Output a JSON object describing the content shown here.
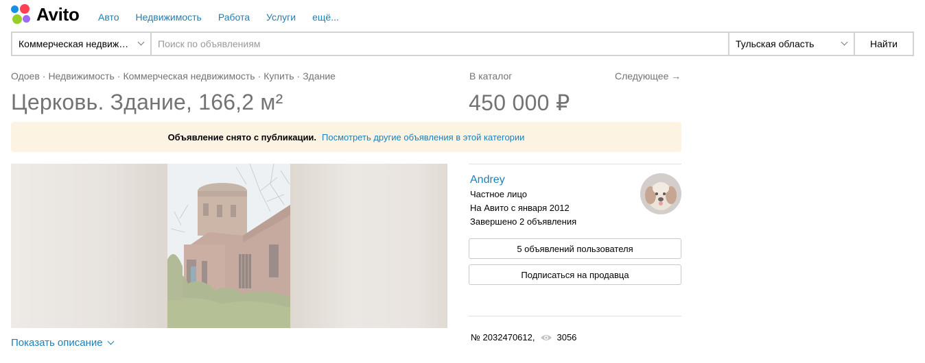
{
  "header": {
    "logo": "Avito",
    "nav": [
      "Авто",
      "Недвижимость",
      "Работа",
      "Услуги",
      "ещё..."
    ]
  },
  "search": {
    "category": "Коммерческая недвиж…",
    "placeholder": "Поиск по объявлениям",
    "region": "Тульская область",
    "button": "Найти"
  },
  "breadcrumb": [
    "Одоев",
    "Недвижимость",
    "Коммерческая недвижимость",
    "Купить",
    "Здание"
  ],
  "catalog_link": "В каталог",
  "next_link": "Следующее →",
  "listing": {
    "title": "Церковь. Здание, 166,2 м²",
    "price": "450 000 ₽",
    "show_description": "Показать описание"
  },
  "notice": {
    "text": "Объявление снято с публикации.",
    "link": "Посмотреть другие объявления в этой категории"
  },
  "seller": {
    "name": "Andrey",
    "type": "Частное лицо",
    "since": "На Авито с января 2012",
    "completed": "Завершено 2 объявления",
    "listings_button": "5 объявлений пользователя",
    "subscribe_button": "Подписаться на продавца"
  },
  "meta": {
    "number": "№ 2032470612,",
    "views": "3056"
  },
  "colors": {
    "link": "#1c7fb5",
    "notice_bg": "#fdf3e3",
    "muted": "#737373"
  }
}
